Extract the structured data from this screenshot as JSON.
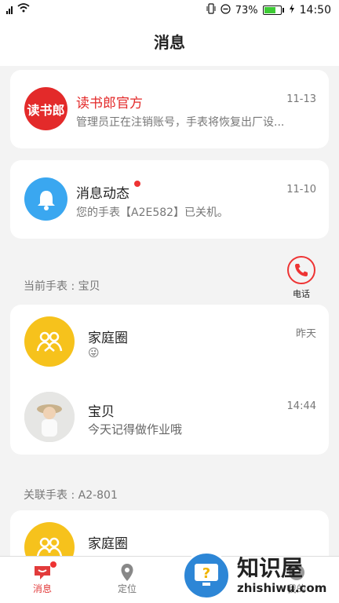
{
  "status_bar": {
    "battery": "73%",
    "time": "14:50"
  },
  "header": {
    "title": "消息"
  },
  "official": {
    "name": "读书郎官方",
    "logo_text": "读书郎",
    "preview": "管理员正在注销账号，手表将恢复出厂设...",
    "time": "11-13"
  },
  "dynamics": {
    "name": "消息动态",
    "preview": "您的手表【A2E582】已关机。",
    "time": "11-10"
  },
  "current_watch": {
    "label": "当前手表 : 宝贝",
    "phone_label": "电话"
  },
  "family_circle": {
    "name": "家庭圈",
    "preview": "😜",
    "time": "昨天"
  },
  "baby": {
    "name": "宝贝",
    "preview": "今天记得做作业哦",
    "time": "14:44"
  },
  "linked_watch": {
    "label": "关联手表 : A2-801"
  },
  "linked_family": {
    "name": "家庭圈"
  },
  "bottom_nav": {
    "items": [
      {
        "label": "消息"
      },
      {
        "label": "定位"
      },
      {
        "label": ""
      },
      {
        "label": "我的"
      }
    ]
  },
  "watermark": {
    "cn": "知识屋",
    "en": "zhishiwu.com"
  }
}
